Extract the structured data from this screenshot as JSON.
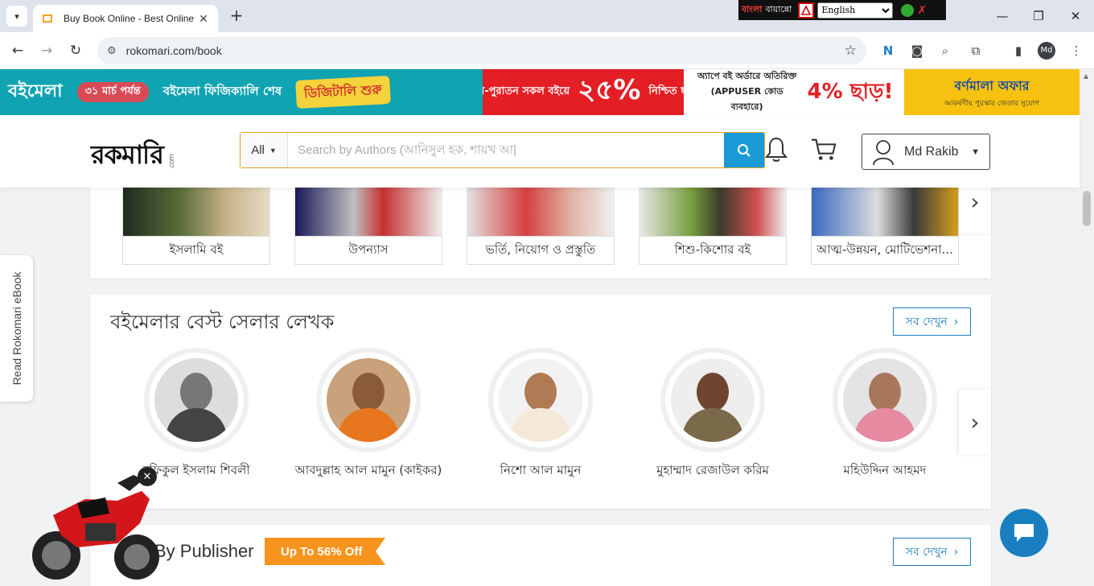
{
  "browser": {
    "tab_title": "Buy Book Online - Best Online B",
    "tab_close": "✕",
    "new_tab": "+",
    "url": "rokomari.com/book",
    "extension": {
      "label_bn": "বাংলা",
      "label_bn2": "বায়ান্নো",
      "language": "English"
    }
  },
  "banner": {
    "date_text": "৩১ মার্চ পর্যন্ত",
    "fair_text": "বইমেলা ফিজিক্যালি শেষ",
    "digital_text": "ডিজিটালি শুরু",
    "logo_text": "বইমেলা",
    "discount_text": "নতুন-পুরাতন সকল বইয়ে",
    "discount_big": "২৫%",
    "discount_suffix": "নিশ্চিত ছাড়!",
    "app_text": "অ্যাপে বই অর্ডারে অতিরিক্ত (APPUSER কোড ব্যবহারে)",
    "app_pct": "4% ছাড়!",
    "offer_title": "বর্ণমালা অফার",
    "offer_sub": "আকর্ষণীয় পুরস্কার জেতার সুযোগ"
  },
  "header": {
    "logo": "রকমারি",
    "logo_com": ".com",
    "category": "All",
    "search_placeholder": "Search by Authors (আনিসুল হক, শায়খ আ|",
    "user_name": "Md Rakib"
  },
  "categories": [
    {
      "label": "ইসলামি বই"
    },
    {
      "label": "উপন্যাস"
    },
    {
      "label": "ভর্তি, নিয়োগ ও প্রস্তুতি"
    },
    {
      "label": "শিশু-কিশোর বই"
    },
    {
      "label": "আত্ম-উন্নয়ন, মোটিভেশনা..."
    }
  ],
  "authors_section": {
    "title": "বইমেলার বেস্ট সেলার লেখক",
    "see_all": "সব দেখুন",
    "authors": [
      {
        "name": "রফিকুল ইসলাম শিবলী"
      },
      {
        "name": "আবদুল্লাহ আল মামুন (কাইকর)"
      },
      {
        "name": "নিশো আল মামুন"
      },
      {
        "name": "মুহাম্মাদ রেজাউল করিম"
      },
      {
        "name": "মহিউদ্দিন আহমদ"
      }
    ]
  },
  "publisher_section": {
    "title": "By Publisher",
    "tag": "Up To 56% Off",
    "see_all": "সব দেখুন"
  },
  "floating": {
    "ebook": "Read Rokomari eBook"
  },
  "colors": {
    "accent": "#1a9bd7",
    "link": "#1a7fc1",
    "tag": "#f7941d",
    "banner_teal": "#10a3b1",
    "banner_red": "#e31e24"
  }
}
